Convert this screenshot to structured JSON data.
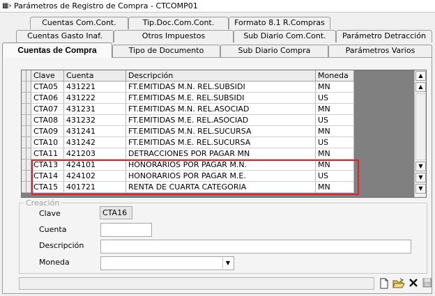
{
  "window": {
    "title": "Parámetros de Registro de Compra - CTCOMP01"
  },
  "tabs": [
    {
      "label": "Cuentas Com.Cont."
    },
    {
      "label": "Tip.Doc.Com.Cont."
    },
    {
      "label": "Formato 8.1 R.Compras"
    },
    {
      "label": "Cuentas Gasto Inaf."
    },
    {
      "label": "Otros Impuestos"
    },
    {
      "label": "Sub Diario Com.Cont."
    },
    {
      "label": "Parámetro Detracción"
    },
    {
      "label": "Cuentas de Compra"
    },
    {
      "label": "Tipo de Documento"
    },
    {
      "label": "Sub Diario Compra"
    },
    {
      "label": "Parámetros Varios"
    }
  ],
  "grid": {
    "columns": [
      "Clave",
      "Cuenta",
      "Descripción",
      "Moneda"
    ],
    "rows": [
      [
        "CTA05",
        "431221",
        "FT.EMITIDAS M.N. REL.SUBSIDI",
        "MN"
      ],
      [
        "CTA06",
        "431222",
        "FT.EMITIDAS M.E. REL.SUBSIDI",
        "US"
      ],
      [
        "CTA07",
        "431231",
        "FT.EMITIDAS M.N. REL.ASOCIAD",
        "MN"
      ],
      [
        "CTA08",
        "431232",
        "FT.EMITIDAS M.E. REL.ASOCIAD",
        "US"
      ],
      [
        "CTA09",
        "431241",
        "FT.EMITIDAS M.N. REL.SUCURSA",
        "MN"
      ],
      [
        "CTA10",
        "431242",
        "FT.EMITIDAS M.E. REL.SUCURSA",
        "US"
      ],
      [
        "CTA11",
        "421203",
        "DETRACCIONES POR PAGAR MN",
        "MN"
      ],
      [
        "CTA13",
        "424101",
        "HONORARIOS POR PAGAR M.N.",
        "MN"
      ],
      [
        "CTA14",
        "424102",
        "HONORARIOS POR PAGAR M.E.",
        "US"
      ],
      [
        "CTA15",
        "401721",
        "RENTA DE CUARTA CATEGORIA",
        "MN"
      ]
    ]
  },
  "form": {
    "legend": "Creación",
    "clave_label": "Clave",
    "clave_value": "CTA16",
    "cuenta_label": "Cuenta",
    "cuenta_value": "",
    "descripcion_label": "Descripción",
    "descripcion_value": "",
    "moneda_label": "Moneda",
    "moneda_value": ""
  },
  "colors": {
    "highlight": "#e0202a",
    "grid_background": "#808080"
  }
}
